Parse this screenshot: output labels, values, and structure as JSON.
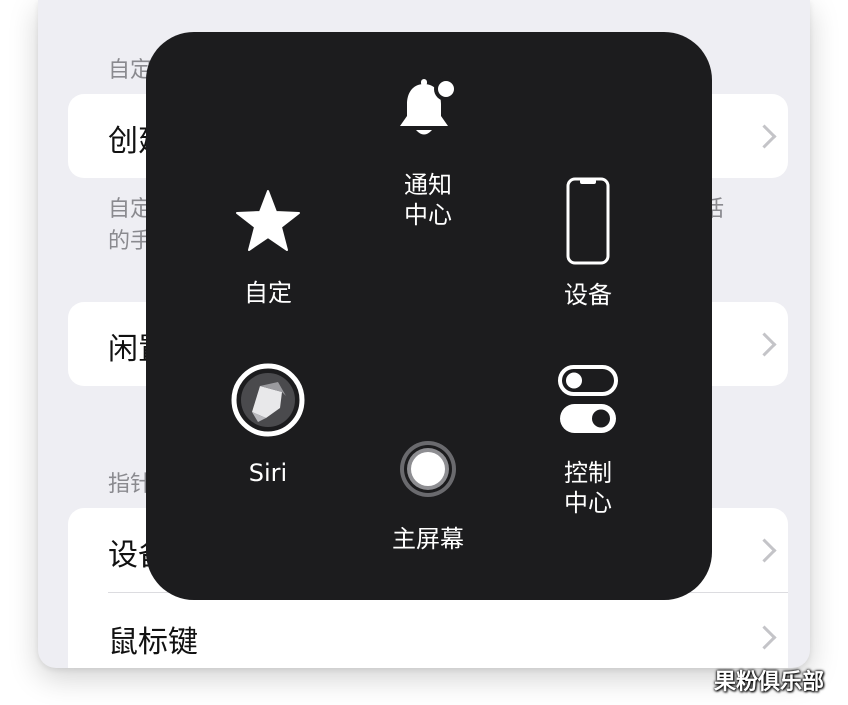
{
  "background": {
    "sections": [
      {
        "label": "自定"
      },
      {
        "label": "指针"
      }
    ],
    "rows": [
      {
        "title": "创建"
      },
      {
        "title": "闲置"
      },
      {
        "title": "设备"
      },
      {
        "title": "鼠标键"
      }
    ],
    "description": {
      "line1_left": "自定",
      "line1_right": "话",
      "line2_left": "的手"
    }
  },
  "menu": {
    "items": [
      {
        "id": "notification",
        "label": "通知\n中心",
        "icon": "bell-icon"
      },
      {
        "id": "custom",
        "label": "自定",
        "icon": "star-icon"
      },
      {
        "id": "device",
        "label": "设备",
        "icon": "phone-icon"
      },
      {
        "id": "siri",
        "label": "Siri",
        "icon": "siri-icon"
      },
      {
        "id": "home",
        "label": "主屏幕",
        "icon": "home-button-icon"
      },
      {
        "id": "control",
        "label": "控制\n中心",
        "icon": "toggles-icon"
      }
    ]
  },
  "watermark": "果粉俱乐部",
  "colors": {
    "overlay": "#1c1c1e",
    "screen_bg": "#eeeef3",
    "card": "#ffffff",
    "secondary_text": "#8a8a8f"
  }
}
